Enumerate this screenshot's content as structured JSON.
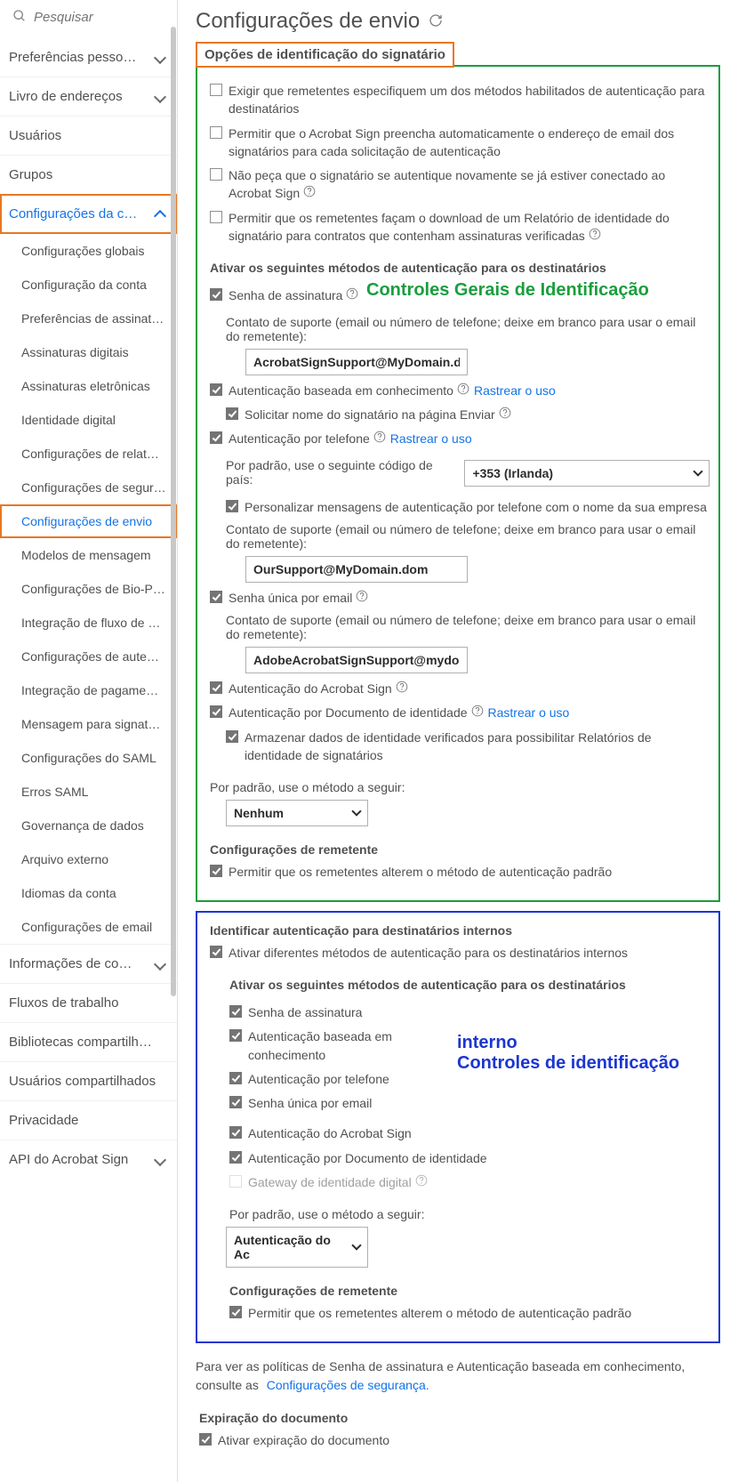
{
  "search": {
    "placeholder": "Pesquisar"
  },
  "sidebar": {
    "s1": "Preferências pesso…",
    "s2": "Livro de endereços",
    "s3": "Usuários",
    "s4": "Grupos",
    "s5": "Configurações da c…",
    "items": [
      "Configurações globais",
      "Configuração da conta",
      "Preferências de assinat…",
      "Assinaturas digitais",
      "Assinaturas eletrônicas",
      "Identidade digital",
      "Configurações de relat…",
      "Configurações de segur…",
      "Configurações de envio",
      "Modelos de mensagem",
      "Configurações de Bio-P…",
      "Integração de fluxo de …",
      "Configurações de aute…",
      "Integração de pagame…",
      "Mensagem para signat…",
      "Configurações do SAML",
      "Erros SAML",
      "Governança de dados",
      "Arquivo externo",
      "Idiomas da conta",
      "Configurações de email"
    ],
    "s6": "Informações de co…",
    "s7": "Fluxos de trabalho",
    "s8": "Bibliotecas compartilh…",
    "s9": "Usuários compartilhados",
    "s10": "Privacidade",
    "s11": "API do Acrobat Sign"
  },
  "page": {
    "title": "Configurações de envio",
    "section_title": "Opções de identificação do signatário",
    "opts": {
      "o1": "Exigir que remetentes especifiquem um dos métodos habilitados de autenticação para destinatários",
      "o2": "Permitir que o Acrobat Sign preencha automaticamente o endereço de email dos signatários para cada solicitação de autenticação",
      "o3": "Não peça que o signatário se autentique novamente se já estiver conectado ao Acrobat Sign",
      "o4": "Permitir que os remetentes façam o download de um Relatório de identidade do signatário para contratos que contenham assinaturas verificadas"
    },
    "auth_hdr": "Ativar os seguintes métodos de autenticação para os destinatários",
    "auth": {
      "a1": "Senha de assinatura",
      "contact_note": "Contato de suporte (email ou número de telefone; deixe em branco para usar o email do remetente):",
      "contact1": "AcrobatSignSupport@MyDomain.dom",
      "a2": "Autenticação baseada em conhecimento",
      "track": "Rastrear o uso",
      "a2b": "Solicitar nome do signatário na página Enviar",
      "a3": "Autenticação por telefone",
      "a3_country_label": "Por padrão, use o seguinte código de país:",
      "a3_country": "+353 (Irlanda)",
      "a3b": "Personalizar mensagens de autenticação por telefone com o nome da sua empresa",
      "contact2": "OurSupport@MyDomain.dom",
      "a4": "Senha única por email",
      "contact3": "AdobeAcrobatSignSupport@mydomain.dom",
      "a5": "Autenticação do Acrobat Sign",
      "a6": "Autenticação por Documento de identidade",
      "a6b": "Armazenar dados de identidade verificados para possibilitar Relatórios de identidade de signatários"
    },
    "default_method_label": "Por padrão, use o método a seguir:",
    "default_method": "Nenhum",
    "sender_settings": "Configurações de remetente",
    "sender_allow": "Permitir que os remetentes alterem o método de autenticação padrão",
    "annot_green": "Controles Gerais de Identificação",
    "internal": {
      "title": "Identificar autenticação para destinatários internos",
      "enable": "Ativar diferentes métodos de autenticação para os destinatários internos",
      "hdr": "Ativar os seguintes métodos de autenticação para os destinatários",
      "i1": "Senha de assinatura",
      "i2": "Autenticação baseada em conhecimento",
      "i3": "Autenticação por telefone",
      "i4": "Senha única por email",
      "i5": "Autenticação do Acrobat Sign",
      "i6": "Autenticação por Documento de identidade",
      "i7": "Gateway de identidade digital",
      "default_method": "Autenticação do Ac",
      "sender_settings": "Configurações de remetente",
      "sender_allow": "Permitir que os remetentes alterem o método de autenticação padrão",
      "annot1": "interno",
      "annot2": "Controles de identificação"
    },
    "footer": {
      "text": "Para ver as políticas de Senha de assinatura e Autenticação baseada em conhecimento, consulte as ",
      "link": "Configurações de segurança."
    },
    "exp": {
      "title": "Expiração do documento",
      "cb": "Ativar expiração do documento"
    }
  }
}
